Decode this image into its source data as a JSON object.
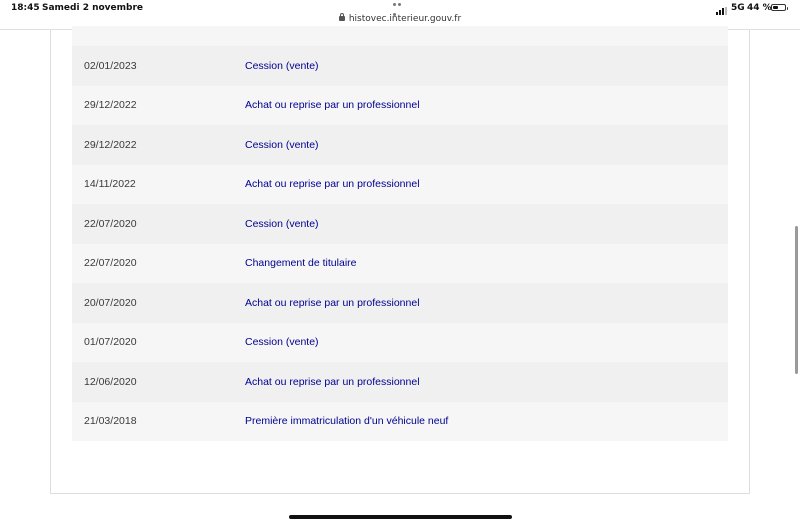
{
  "status_bar": {
    "time": "18:45",
    "date": "Samedi 2 novembre",
    "network": "5G",
    "battery": "44 %",
    "battery_level": 0.44
  },
  "browser": {
    "url": "histovec.interieur.gouv.fr"
  },
  "history": {
    "rows": [
      {
        "date": "02/01/2023",
        "operation": "Cession (vente)"
      },
      {
        "date": "29/12/2022",
        "operation": "Achat ou reprise par un professionnel"
      },
      {
        "date": "29/12/2022",
        "operation": "Cession (vente)"
      },
      {
        "date": "14/11/2022",
        "operation": "Achat ou reprise par un professionnel"
      },
      {
        "date": "22/07/2020",
        "operation": "Cession (vente)"
      },
      {
        "date": "22/07/2020",
        "operation": "Changement de titulaire"
      },
      {
        "date": "20/07/2020",
        "operation": "Achat ou reprise par un professionnel"
      },
      {
        "date": "01/07/2020",
        "operation": "Cession (vente)"
      },
      {
        "date": "12/06/2020",
        "operation": "Achat ou reprise par un professionnel"
      },
      {
        "date": "21/03/2018",
        "operation": "Première immatriculation d'un véhicule neuf"
      }
    ]
  },
  "colors": {
    "link": "#000091",
    "row_dark": "#f0f0f0",
    "row_light": "#f6f6f6"
  }
}
